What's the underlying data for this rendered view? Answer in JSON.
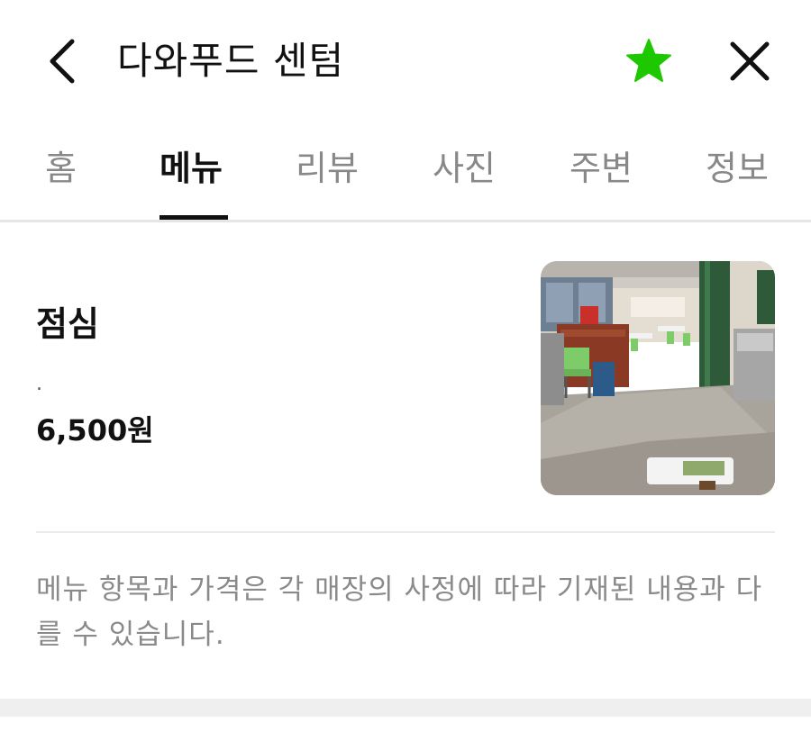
{
  "header": {
    "title": "다와푸드 센텀",
    "back_icon": "chevron-left-icon",
    "favorite_icon": "star-icon",
    "close_icon": "close-icon",
    "accent_color": "#1ec800"
  },
  "tabs": [
    {
      "label": "홈",
      "active": false
    },
    {
      "label": "메뉴",
      "active": true
    },
    {
      "label": "리뷰",
      "active": false
    },
    {
      "label": "사진",
      "active": false
    },
    {
      "label": "주변",
      "active": false
    },
    {
      "label": "정보",
      "active": false
    }
  ],
  "menu": {
    "items": [
      {
        "name": "점심",
        "description": ".",
        "price": "6,500원"
      }
    ]
  },
  "notice": {
    "text": "메뉴 항목과 가격은 각 매장의 사정에 따라 기재된 내용과 다를 수 있습니다."
  }
}
